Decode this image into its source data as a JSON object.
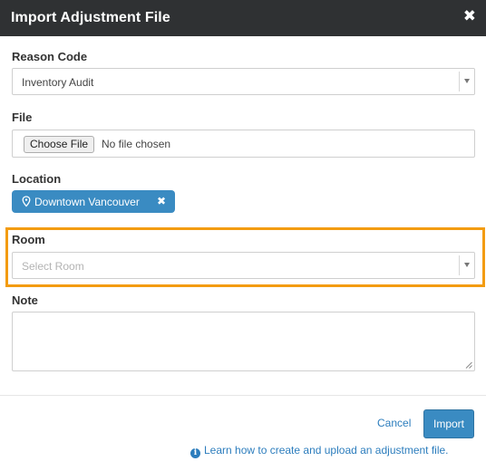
{
  "modal": {
    "title": "Import Adjustment File",
    "close_glyph": "✖"
  },
  "reason_code": {
    "label": "Reason Code",
    "value": "Inventory Audit"
  },
  "file": {
    "label": "File",
    "button_label": "Choose File",
    "status": "No file chosen"
  },
  "location": {
    "label": "Location",
    "chip_label": "Downtown Vancouver",
    "remove_glyph": "✖"
  },
  "room": {
    "label": "Room",
    "placeholder": "Select Room"
  },
  "note": {
    "label": "Note",
    "value": ""
  },
  "footer": {
    "cancel_label": "Cancel",
    "import_label": "Import",
    "help_icon_glyph": "i",
    "help_link": "Learn how to create and upload an adjustment file."
  },
  "colors": {
    "header_bg": "#2f3133",
    "accent": "#3a8bc2",
    "link": "#2c7dbd",
    "highlight": "#f39c12"
  },
  "icons": [
    "close-icon",
    "chevron-down-icon",
    "map-pin-icon",
    "info-icon",
    "resize-grip-icon"
  ]
}
